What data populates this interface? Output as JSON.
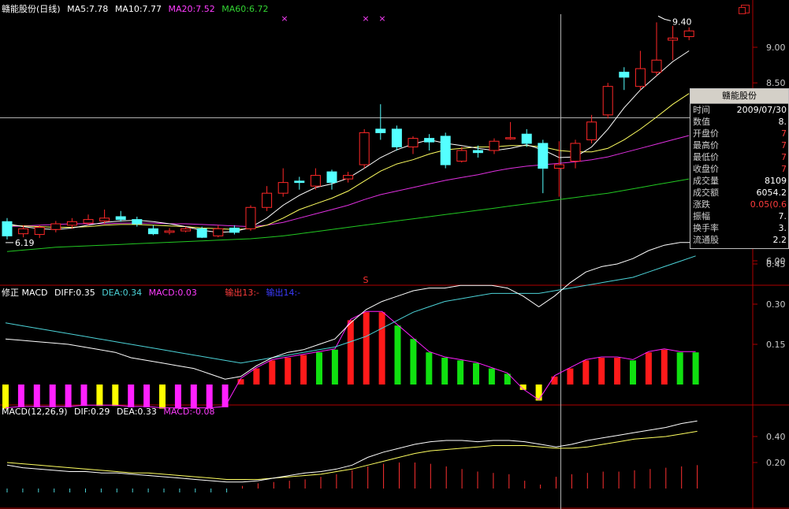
{
  "title": "赣能股份(日线)",
  "ma_legend": [
    {
      "label": "MA5:7.78",
      "color": "#ffffff"
    },
    {
      "label": "MA10:7.77",
      "color": "#ffffff"
    },
    {
      "label": "MA20:7.52",
      "color": "#ff3cff"
    },
    {
      "label": "MA60:6.72",
      "color": "#32d232"
    }
  ],
  "indicator1": {
    "name": "修正 MACD",
    "items": [
      {
        "label": "DIFF:0.35",
        "color": "#ffffff"
      },
      {
        "label": "DEA:0.34",
        "color": "#4cd3d8"
      },
      {
        "label": "MACD:0.03",
        "color": "#ff3cff"
      },
      {
        "label": "输出13:-",
        "color": "#ff3c3c"
      },
      {
        "label": "输出14:-",
        "color": "#3c3cff"
      }
    ]
  },
  "indicator2": {
    "name": "MACD(12,26,9)",
    "items": [
      {
        "label": "DIF:0.29",
        "color": "#ffffff"
      },
      {
        "label": "DEA:0.33",
        "color": "#ffffff"
      },
      {
        "label": "MACD:-0.08",
        "color": "#ff3cff"
      }
    ]
  },
  "price_axis": [
    "9.00",
    "8.50",
    "6.00"
  ],
  "xz_axis": [
    "0.45",
    "0.30",
    "0.15"
  ],
  "macd_axis": [
    "0.40",
    "0.20"
  ],
  "high_label": "9.40",
  "low_label": "6.19",
  "markers": {
    "x": "×",
    "s": "S"
  },
  "info_panel": {
    "title": "赣能股份",
    "rows": [
      {
        "label": "时间",
        "value": "2009/07/30",
        "color": "#ffffff"
      },
      {
        "label": "数值",
        "value": "8.",
        "color": "#ffffff"
      },
      {
        "label": "开盘价",
        "value": "7",
        "color": "#ff3c3c"
      },
      {
        "label": "最高价",
        "value": "7",
        "color": "#ff3c3c"
      },
      {
        "label": "最低价",
        "value": "7",
        "color": "#ff3c3c"
      },
      {
        "label": "收盘价",
        "value": "7",
        "color": "#ff3c3c"
      },
      {
        "label": "成交量",
        "value": "8109",
        "color": "#ffffff"
      },
      {
        "label": "成交额",
        "value": "6054.2",
        "color": "#ffffff"
      },
      {
        "label": "涨跌",
        "value": "0.05(0.6",
        "color": "#ff3c3c"
      },
      {
        "label": "振幅",
        "value": "7.",
        "color": "#ffffff"
      },
      {
        "label": "换手率",
        "value": "3.",
        "color": "#ffffff"
      },
      {
        "label": "流通股",
        "value": "2.2",
        "color": "#ffffff"
      }
    ]
  },
  "colors": {
    "up": "#ff2828",
    "down": "#54ffff",
    "axis": "#b00000",
    "cursor": "#b0b0b0",
    "xz_red": "#ff1a1a",
    "xz_green": "#10e010",
    "xz_magenta": "#ff20ff",
    "xz_yellow": "#ffff00"
  },
  "chart_data": {
    "type": "candlestick",
    "candles": [
      {
        "o": 6.55,
        "c": 6.35,
        "h": 6.6,
        "l": 6.3
      },
      {
        "o": 6.38,
        "c": 6.45,
        "h": 6.5,
        "l": 6.33
      },
      {
        "o": 6.37,
        "c": 6.47,
        "h": 6.5,
        "l": 6.32
      },
      {
        "o": 6.44,
        "c": 6.52,
        "h": 6.56,
        "l": 6.4
      },
      {
        "o": 6.5,
        "c": 6.55,
        "h": 6.6,
        "l": 6.45
      },
      {
        "o": 6.53,
        "c": 6.58,
        "h": 6.65,
        "l": 6.5
      },
      {
        "o": 6.56,
        "c": 6.6,
        "h": 6.72,
        "l": 6.52
      },
      {
        "o": 6.62,
        "c": 6.58,
        "h": 6.7,
        "l": 6.55
      },
      {
        "o": 6.58,
        "c": 6.52,
        "h": 6.62,
        "l": 6.48
      },
      {
        "o": 6.45,
        "c": 6.38,
        "h": 6.5,
        "l": 6.36
      },
      {
        "o": 6.4,
        "c": 6.42,
        "h": 6.46,
        "l": 6.37
      },
      {
        "o": 6.42,
        "c": 6.45,
        "h": 6.48,
        "l": 6.4
      },
      {
        "o": 6.45,
        "c": 6.33,
        "h": 6.48,
        "l": 6.32
      },
      {
        "o": 6.35,
        "c": 6.45,
        "h": 6.5,
        "l": 6.33
      },
      {
        "o": 6.46,
        "c": 6.4,
        "h": 6.5,
        "l": 6.37
      },
      {
        "o": 6.45,
        "c": 6.75,
        "h": 6.78,
        "l": 6.42
      },
      {
        "o": 6.75,
        "c": 6.95,
        "h": 7.05,
        "l": 6.7
      },
      {
        "o": 6.95,
        "c": 7.1,
        "h": 7.3,
        "l": 6.9
      },
      {
        "o": 7.12,
        "c": 7.1,
        "h": 7.18,
        "l": 7.0
      },
      {
        "o": 7.05,
        "c": 7.2,
        "h": 7.3,
        "l": 7.0
      },
      {
        "o": 7.25,
        "c": 7.1,
        "h": 7.28,
        "l": 7.0
      },
      {
        "o": 7.15,
        "c": 7.2,
        "h": 7.25,
        "l": 7.1
      },
      {
        "o": 7.35,
        "c": 7.8,
        "h": 7.85,
        "l": 7.3
      },
      {
        "o": 7.85,
        "c": 7.8,
        "h": 8.2,
        "l": 7.7
      },
      {
        "o": 7.85,
        "c": 7.6,
        "h": 7.9,
        "l": 7.55
      },
      {
        "o": 7.6,
        "c": 7.72,
        "h": 7.75,
        "l": 7.5
      },
      {
        "o": 7.72,
        "c": 7.67,
        "h": 7.78,
        "l": 7.55
      },
      {
        "o": 7.75,
        "c": 7.35,
        "h": 7.8,
        "l": 7.3
      },
      {
        "o": 7.4,
        "c": 7.55,
        "h": 7.6,
        "l": 7.38
      },
      {
        "o": 7.55,
        "c": 7.52,
        "h": 7.62,
        "l": 7.45
      },
      {
        "o": 7.55,
        "c": 7.68,
        "h": 7.72,
        "l": 7.5
      },
      {
        "o": 7.72,
        "c": 7.73,
        "h": 7.95,
        "l": 7.7
      },
      {
        "o": 7.78,
        "c": 7.65,
        "h": 7.85,
        "l": 7.6
      },
      {
        "o": 7.65,
        "c": 7.3,
        "h": 7.7,
        "l": 6.95
      },
      {
        "o": 7.3,
        "c": 7.35,
        "h": 7.68,
        "l": 6.9
      },
      {
        "o": 7.4,
        "c": 7.65,
        "h": 7.7,
        "l": 7.3
      },
      {
        "o": 7.7,
        "c": 7.95,
        "h": 8.05,
        "l": 7.65
      },
      {
        "o": 8.05,
        "c": 8.45,
        "h": 8.5,
        "l": 8.0
      },
      {
        "o": 8.65,
        "c": 8.58,
        "h": 8.72,
        "l": 8.4
      },
      {
        "o": 8.45,
        "c": 8.7,
        "h": 8.95,
        "l": 8.4
      },
      {
        "o": 8.65,
        "c": 8.82,
        "h": 9.35,
        "l": 8.6
      },
      {
        "o": 9.1,
        "c": 9.13,
        "h": 9.3,
        "l": 8.82
      },
      {
        "o": 9.15,
        "c": 9.23,
        "h": 9.28,
        "l": 9.1
      }
    ],
    "ma5": [
      6.52,
      6.48,
      6.45,
      6.44,
      6.46,
      6.5,
      6.54,
      6.56,
      6.57,
      6.55,
      6.52,
      6.48,
      6.43,
      6.4,
      6.41,
      6.47,
      6.6,
      6.78,
      6.92,
      7.03,
      7.08,
      7.16,
      7.3,
      7.45,
      7.56,
      7.64,
      7.7,
      7.65,
      7.62,
      7.58,
      7.55,
      7.58,
      7.63,
      7.56,
      7.45,
      7.46,
      7.6,
      7.85,
      8.15,
      8.4,
      8.6,
      8.8,
      8.95
    ],
    "ma10": [
      6.5,
      6.49,
      6.48,
      6.47,
      6.47,
      6.48,
      6.5,
      6.51,
      6.51,
      6.5,
      6.49,
      6.48,
      6.46,
      6.45,
      6.44,
      6.45,
      6.5,
      6.6,
      6.72,
      6.8,
      6.88,
      6.98,
      7.12,
      7.26,
      7.36,
      7.42,
      7.5,
      7.56,
      7.58,
      7.6,
      7.6,
      7.62,
      7.62,
      7.6,
      7.55,
      7.53,
      7.53,
      7.58,
      7.7,
      7.85,
      8.02,
      8.2,
      8.35
    ],
    "ma20": [
      6.48,
      6.49,
      6.5,
      6.51,
      6.52,
      6.52,
      6.52,
      6.53,
      6.53,
      6.53,
      6.52,
      6.52,
      6.51,
      6.5,
      6.49,
      6.48,
      6.5,
      6.54,
      6.6,
      6.66,
      6.72,
      6.78,
      6.86,
      6.93,
      6.98,
      7.03,
      7.08,
      7.13,
      7.17,
      7.21,
      7.26,
      7.3,
      7.33,
      7.35,
      7.37,
      7.39,
      7.42,
      7.46,
      7.52,
      7.58,
      7.64,
      7.7,
      7.76
    ],
    "ma60": [
      6.13,
      6.15,
      6.17,
      6.19,
      6.2,
      6.21,
      6.22,
      6.23,
      6.24,
      6.25,
      6.26,
      6.27,
      6.28,
      6.29,
      6.3,
      6.31,
      6.33,
      6.35,
      6.38,
      6.41,
      6.44,
      6.47,
      6.5,
      6.53,
      6.56,
      6.59,
      6.62,
      6.65,
      6.68,
      6.71,
      6.74,
      6.77,
      6.8,
      6.83,
      6.86,
      6.89,
      6.92,
      6.95,
      6.99,
      7.03,
      7.07,
      7.11,
      7.15
    ],
    "xz": {
      "bars": [
        -0.09,
        -0.085,
        -0.085,
        -0.085,
        -0.085,
        -0.08,
        -0.08,
        -0.08,
        -0.085,
        -0.085,
        -0.09,
        -0.09,
        -0.09,
        -0.09,
        -0.085,
        0.02,
        0.06,
        0.09,
        0.1,
        0.11,
        0.12,
        0.13,
        0.24,
        0.27,
        0.27,
        0.22,
        0.17,
        0.12,
        0.1,
        0.09,
        0.08,
        0.06,
        0.04,
        -0.02,
        -0.06,
        0.03,
        0.06,
        0.09,
        0.1,
        0.1,
        0.09,
        0.12,
        0.13,
        0.12,
        0.12
      ],
      "bar_colors": [
        "y",
        "m",
        "m",
        "m",
        "m",
        "m",
        "y",
        "y",
        "m",
        "m",
        "y",
        "m",
        "m",
        "m",
        "m",
        "r",
        "r",
        "r",
        "r",
        "r",
        "g",
        "g",
        "r",
        "r",
        "r",
        "g",
        "g",
        "g",
        "g",
        "g",
        "g",
        "g",
        "g",
        "y",
        "y",
        "r",
        "r",
        "r",
        "r",
        "r",
        "g",
        "r",
        "r",
        "g",
        "g"
      ],
      "diff": [
        0.17,
        0.165,
        0.16,
        0.155,
        0.15,
        0.14,
        0.13,
        0.12,
        0.1,
        0.09,
        0.08,
        0.07,
        0.06,
        0.04,
        0.02,
        0.03,
        0.07,
        0.1,
        0.12,
        0.13,
        0.15,
        0.17,
        0.23,
        0.28,
        0.31,
        0.33,
        0.35,
        0.36,
        0.36,
        0.37,
        0.37,
        0.37,
        0.36,
        0.33,
        0.29,
        0.33,
        0.38,
        0.42,
        0.44,
        0.45,
        0.47,
        0.5,
        0.52,
        0.53,
        0.53
      ],
      "dea": [
        0.23,
        0.22,
        0.21,
        0.2,
        0.19,
        0.18,
        0.17,
        0.16,
        0.15,
        0.14,
        0.13,
        0.12,
        0.11,
        0.1,
        0.09,
        0.08,
        0.09,
        0.1,
        0.11,
        0.12,
        0.13,
        0.14,
        0.16,
        0.18,
        0.21,
        0.24,
        0.27,
        0.29,
        0.31,
        0.32,
        0.33,
        0.34,
        0.34,
        0.34,
        0.34,
        0.35,
        0.36,
        0.37,
        0.38,
        0.39,
        0.4,
        0.42,
        0.44,
        0.46,
        0.48
      ]
    },
    "macd": {
      "bars": [
        -0.03,
        -0.03,
        -0.03,
        -0.03,
        -0.03,
        -0.03,
        -0.03,
        -0.03,
        -0.03,
        -0.03,
        -0.03,
        -0.03,
        -0.03,
        -0.03,
        -0.03,
        0.02,
        0.04,
        0.05,
        0.06,
        0.07,
        0.09,
        0.11,
        0.14,
        0.17,
        0.19,
        0.2,
        0.2,
        0.19,
        0.17,
        0.15,
        0.13,
        0.12,
        0.11,
        0.06,
        0.03,
        0.09,
        0.11,
        0.12,
        0.13,
        0.13,
        0.14,
        0.15,
        0.16,
        0.17,
        0.18
      ],
      "dif": [
        0.18,
        0.16,
        0.15,
        0.14,
        0.13,
        0.13,
        0.12,
        0.12,
        0.11,
        0.1,
        0.09,
        0.08,
        0.07,
        0.06,
        0.05,
        0.05,
        0.06,
        0.08,
        0.1,
        0.12,
        0.13,
        0.15,
        0.18,
        0.24,
        0.28,
        0.31,
        0.34,
        0.36,
        0.37,
        0.37,
        0.36,
        0.37,
        0.37,
        0.36,
        0.34,
        0.32,
        0.34,
        0.37,
        0.39,
        0.41,
        0.43,
        0.45,
        0.47,
        0.5,
        0.52
      ],
      "dea": [
        0.2,
        0.19,
        0.18,
        0.17,
        0.16,
        0.15,
        0.14,
        0.13,
        0.12,
        0.12,
        0.11,
        0.1,
        0.09,
        0.08,
        0.07,
        0.07,
        0.07,
        0.08,
        0.09,
        0.1,
        0.11,
        0.13,
        0.15,
        0.18,
        0.21,
        0.24,
        0.27,
        0.29,
        0.3,
        0.31,
        0.32,
        0.33,
        0.33,
        0.33,
        0.32,
        0.31,
        0.31,
        0.32,
        0.34,
        0.36,
        0.38,
        0.39,
        0.4,
        0.42,
        0.44
      ]
    }
  }
}
